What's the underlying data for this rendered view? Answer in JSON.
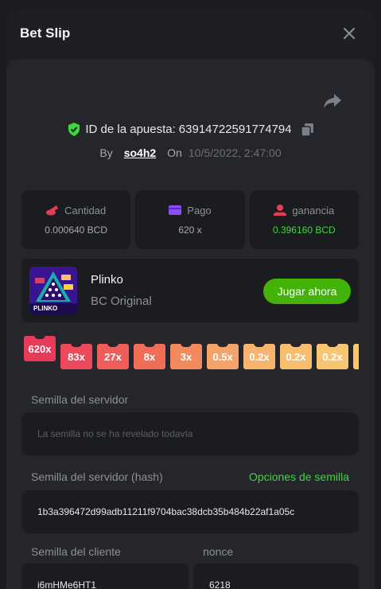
{
  "modal": {
    "title": "Bet Slip"
  },
  "bet": {
    "id_label": "ID de la apuesta:",
    "id_value": "63914722591774794",
    "by_label": "By",
    "username": "so4h2",
    "on_label": "On",
    "date": "10/5/2022, 2:47:00"
  },
  "stats": [
    {
      "label": "Cantidad",
      "value": "0.000640 BCD",
      "icon": "coins-icon"
    },
    {
      "label": "Pago",
      "value": "620 x",
      "icon": "wallet-icon"
    },
    {
      "label": "ganancia",
      "value": "0.396160 BCD",
      "icon": "profit-icon"
    }
  ],
  "game": {
    "name": "Plinko",
    "subtitle": "BC Original",
    "play_label": "Jugar ahora",
    "thumb_text": "PLINKO"
  },
  "multipliers": [
    "620x",
    "83x",
    "27x",
    "8x",
    "3x",
    "0.5x",
    "0.2x",
    "0.2x",
    "0.2x"
  ],
  "seeds": {
    "server_seed_label": "Semilla del servidor",
    "server_seed_placeholder": "La semilla no se ha revelado todavía",
    "server_hash_label": "Semilla del servidor (hash)",
    "seed_options_label": "Opciones de semilla",
    "server_hash_value": "1b3a396472d99adb11211f9704bac38dcb35b484b22af1a05c",
    "client_seed_label": "Semilla del cliente",
    "client_seed_value": "i6mHMe6HT1",
    "nonce_label": "nonce",
    "nonce_value": "6218"
  },
  "colors": {
    "accent_green": "#43b309",
    "profit_green": "#3cd83c",
    "mult_colors": [
      "#e93a5a",
      "#ec4a5c",
      "#ee5d5a",
      "#f06e58",
      "#f28a5e",
      "#f4a36a",
      "#f6b46e",
      "#f7be70",
      "#f8c672"
    ]
  }
}
